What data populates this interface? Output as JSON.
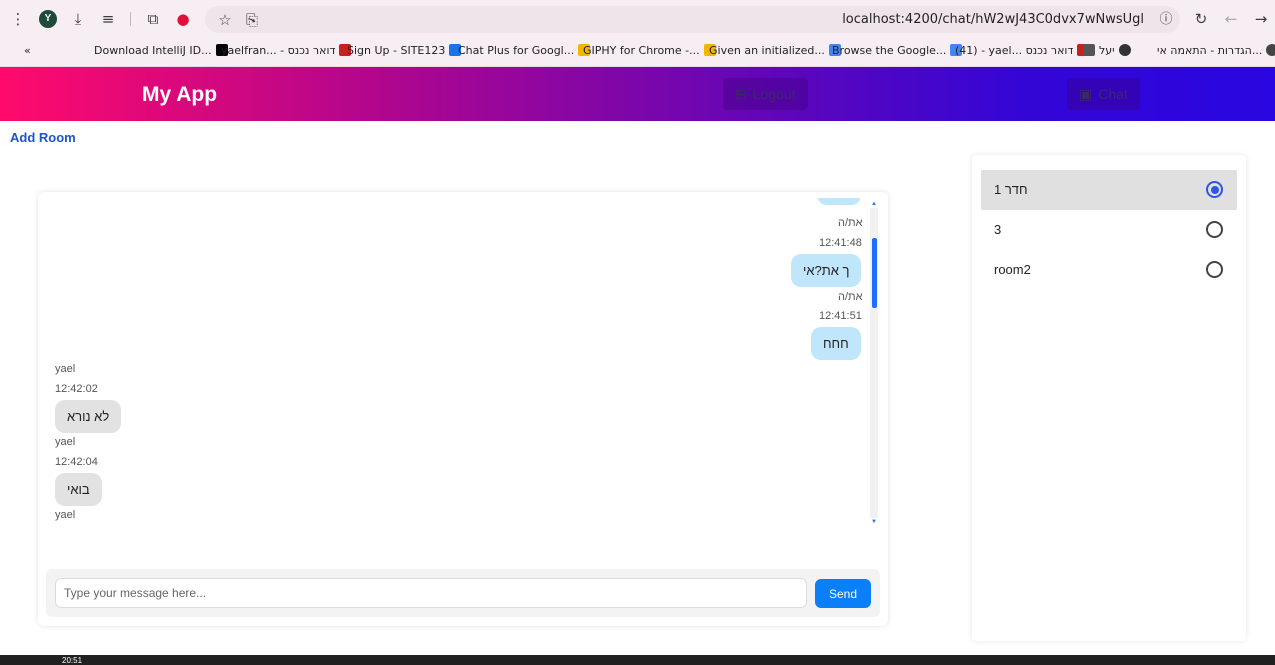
{
  "browser": {
    "url": "localhost:4200/chat/hW2wJ43C0dvx7wNwsUgl",
    "profile_initial": "Y",
    "bookmarks": [
      {
        "label": "Download IntelliJ ID...",
        "color": "#000000"
      },
      {
        "label": "yaelfran... - דואר נכנס",
        "color": "#c5221f"
      },
      {
        "label": "Sign Up - SITE123",
        "color": "#1a73e8"
      },
      {
        "label": "Chat Plus for Googl...",
        "color": "#f5b400"
      },
      {
        "label": "GIPHY for Chrome -...",
        "color": "#f5b400"
      },
      {
        "label": "Given an initialized...",
        "color": "#4285f4"
      },
      {
        "label": "Browse the Google...",
        "color": "#4285f4"
      },
      {
        "label": "(41) - yael... דואר נכנס",
        "color": "#c5221f"
      },
      {
        "label": "יעל",
        "color": "#222222"
      },
      {
        "label": "הגדרות - התאמה אי...",
        "color": "#444444"
      }
    ]
  },
  "header": {
    "brand": "My App",
    "logout_label": "Logout",
    "chat_label": "Chat"
  },
  "actions": {
    "add_room": "Add Room"
  },
  "messages": [
    {
      "type": "mine-partial"
    },
    {
      "sender": "את/ה",
      "time": "12:41:48",
      "text": "ך את?אי",
      "mine": true
    },
    {
      "sender": "את/ה",
      "time": "12:41:51",
      "text": "חחח",
      "mine": true
    },
    {
      "sender": "yael",
      "time": "12:42:02",
      "text": "לא נורא",
      "mine": false
    },
    {
      "sender": "yael",
      "time": "12:42:04",
      "text": "בואי",
      "mine": false
    },
    {
      "sender": "yael"
    }
  ],
  "composer": {
    "placeholder": "Type your message here...",
    "value": "",
    "send_label": "Send"
  },
  "rooms": {
    "selected": "חדר 1",
    "items": [
      {
        "label": "חדר 1",
        "selected": true
      },
      {
        "label": "3",
        "selected": false
      },
      {
        "label": "room2",
        "selected": false
      }
    ]
  },
  "taskbar": {
    "time": "20:51"
  },
  "colors": {
    "mine_bubble": "#bfe6fb",
    "their_bubble": "#e2e2e2",
    "accent": "#0a7ff7",
    "radio_selected": "#2f55e6"
  }
}
